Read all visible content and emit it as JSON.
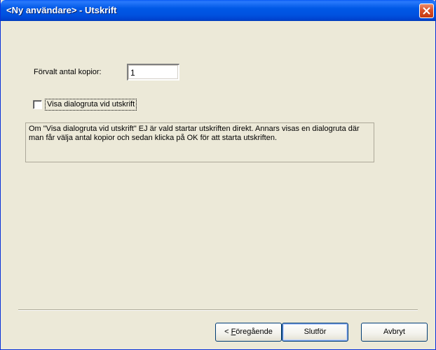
{
  "window": {
    "title": "<Ny användare> - Utskrift",
    "close_icon": "close-icon"
  },
  "copies": {
    "label": "Förvalt antal kopior:",
    "value": "1"
  },
  "print_dialog": {
    "label": "Visa dialogruta vid utskrift",
    "checked": false
  },
  "info_text": "Om \"Visa dialogruta vid utskrift\" EJ är vald startar utskriften direkt. Annars visas en dialogruta där man får välja antal kopior och sedan klicka på OK för att starta utskriften.",
  "buttons": {
    "back_prefix": "< ",
    "back_mnemonic": "F",
    "back_rest": "öregående",
    "finish": "Slutför",
    "cancel": "Avbryt"
  },
  "colors": {
    "titlebar": "#0058e6",
    "dialog_bg": "#ece9d8",
    "close_button": "#d9502a"
  }
}
